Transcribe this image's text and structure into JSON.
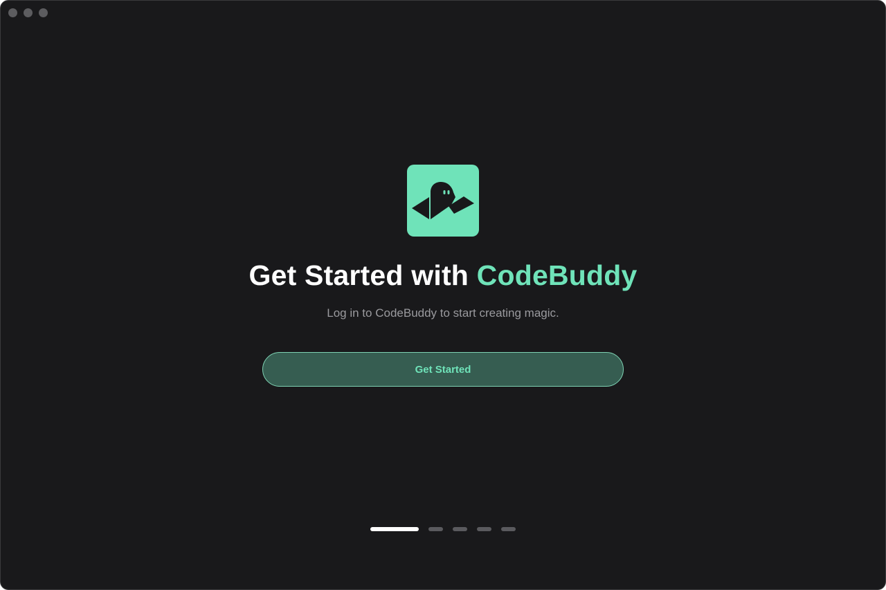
{
  "window": {
    "controls": [
      "close",
      "minimize",
      "zoom"
    ]
  },
  "hero": {
    "logo_icon": "ghost-on-paper-plane-icon",
    "title_prefix": "Get Started with ",
    "title_brand": "CodeBuddy",
    "subtitle": "Log in to CodeBuddy to start creating magic.",
    "cta_label": "Get Started"
  },
  "pager": {
    "total": 5,
    "active_index": 0
  },
  "colors": {
    "background": "#19191b",
    "accent": "#6fe3b9",
    "button_fill": "#365d51",
    "muted_text": "#9a9a9e"
  }
}
